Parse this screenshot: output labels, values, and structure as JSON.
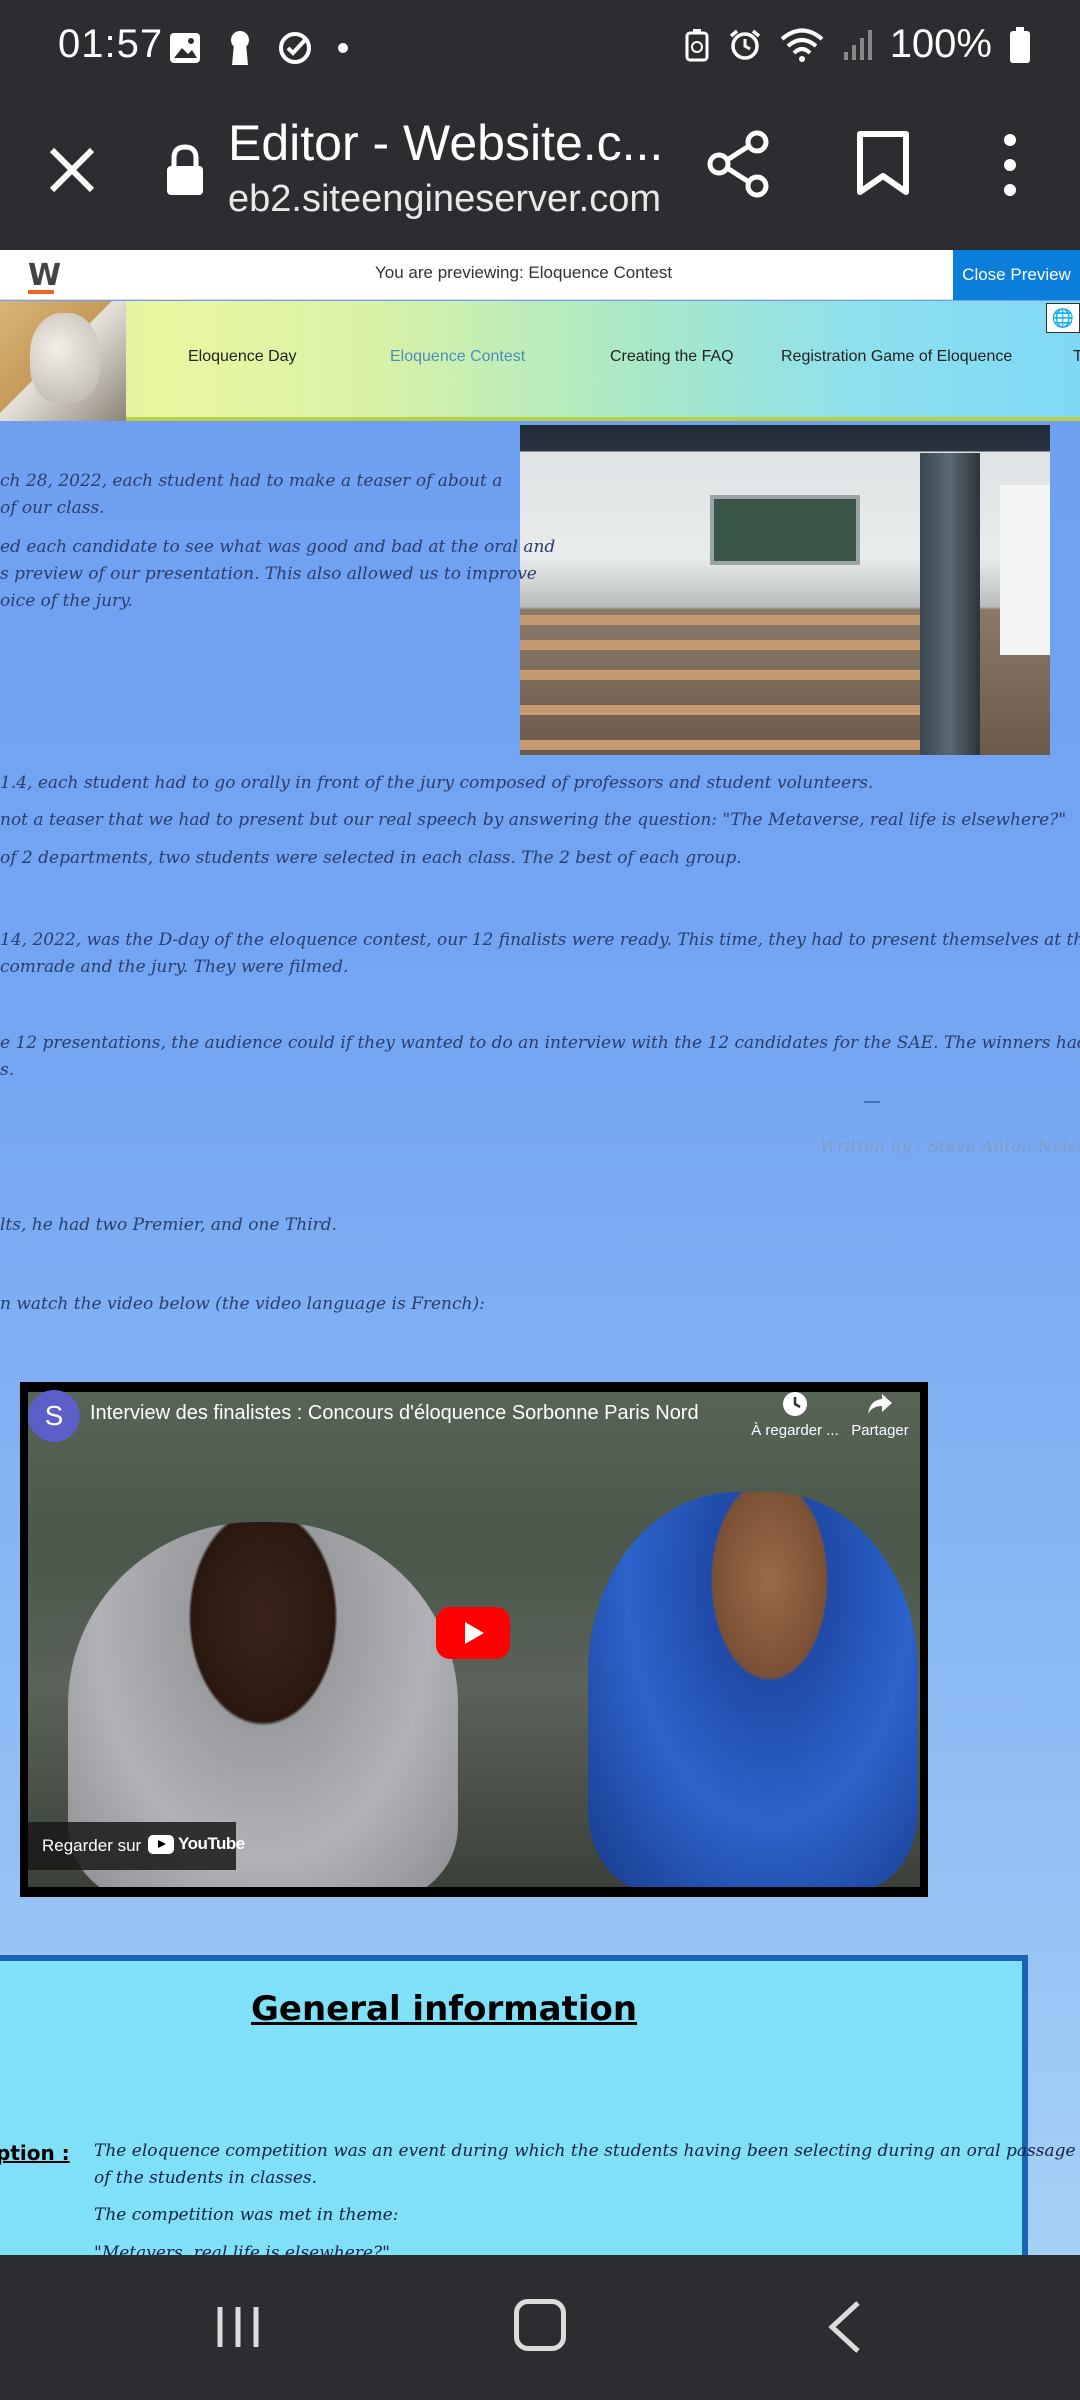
{
  "status_bar": {
    "time": "01:57",
    "battery": "100%",
    "left_icons": [
      "image-icon",
      "keyhole-icon",
      "check-circle-icon",
      "dot-icon"
    ],
    "right_icons": [
      "battery-saver-icon",
      "alarm-icon",
      "wifi-icon",
      "signal-icon",
      "battery-icon"
    ]
  },
  "browser": {
    "title": "Editor - Website.c...",
    "url": "eb2.siteengineserver.com"
  },
  "preview": {
    "logo": "W",
    "text": "You are previewing: Eloquence Contest",
    "close_label": "Close Preview"
  },
  "nav": {
    "items": [
      {
        "label": "Eloquence Day"
      },
      {
        "label": "Eloquence Contest"
      },
      {
        "label": "Creating the FAQ"
      },
      {
        "label": "Registration Game of Eloquence"
      },
      {
        "label": "T"
      }
    ]
  },
  "article": {
    "l0": "ch 28, 2022, each student had to make a teaser of about a",
    "l1": "of our class.",
    "l2": "ed each candidate to see what was good and bad at the oral and",
    "l3": "s preview of our presentation. This also allowed us to improve",
    "l4": "oice of the jury.",
    "l5": "1.4, each student had to go orally in front of the jury composed of professors and student volunteers.",
    "l6": "not a teaser that we had to present but our real speech by answering the question: \"The Metaverse, real life is elsewhere?\"",
    "l7": "of 2 departments, two students were selected in each class. The 2 best of each group.",
    "l8": "14, 2022, was the D-day of the eloquence contest, our 12 finalists were ready. This time, they had to present themselves at the IUT amphitheatre",
    "l9": "comrade and the jury. They were filmed.",
    "l10": "e 12 presentations, the audience could if they wanted to do an interview with the 12 candidates for the SAE. The winners had won a Fnac voucher",
    "l11": "s.",
    "author": "Written by : Steve Anton Nelson",
    "l12": "lts, he had two Premier, and one Third.",
    "l13": "n watch the video below (the video language is French):"
  },
  "video": {
    "channel_initial": "S",
    "title": "Interview des finalistes : Concours d'éloquence Sorbonne Paris Nord",
    "watch_later": "À regarder ...",
    "share": "Partager",
    "watch_on": "Regarder sur",
    "youtube": "YouTube"
  },
  "general": {
    "title": "General information",
    "label": "ption :",
    "t1": "The eloquence competition was an event during which the students having been selecting during an oral passage phase",
    "t2": "of the students in classes.",
    "t3": "The competition was met in theme:",
    "t4": "\"Metavers, real life is elsewhere?\""
  }
}
